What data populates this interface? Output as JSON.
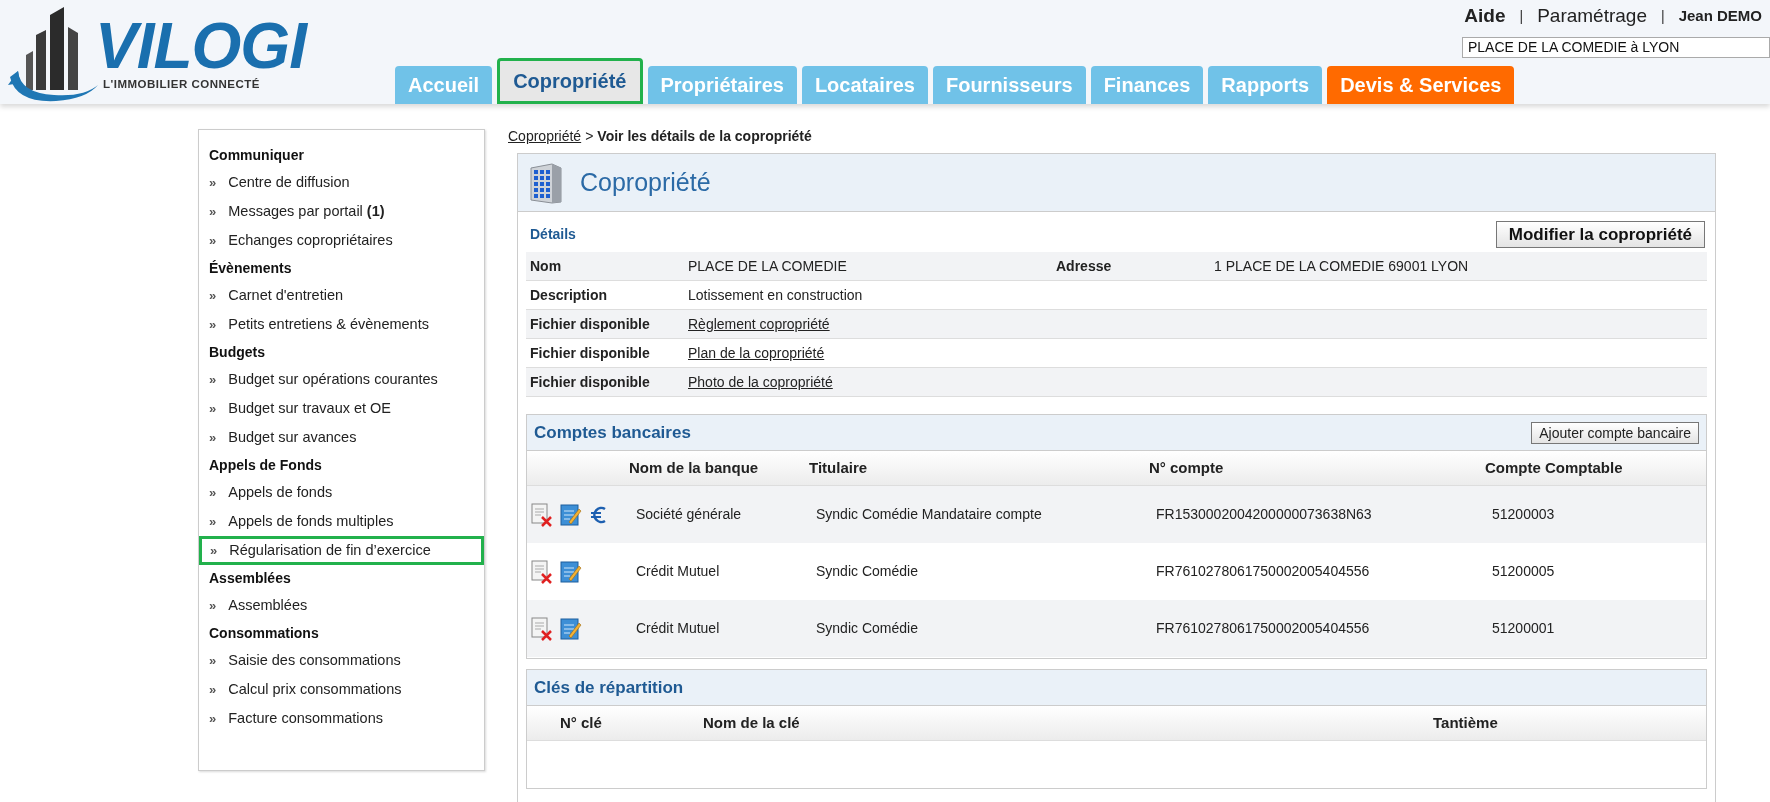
{
  "header": {
    "logo": {
      "name": "VILOGI",
      "tagline": "L'IMMOBILIER CONNECTÉ"
    },
    "top_links": [
      {
        "label": "Aide",
        "kind": "bold"
      },
      {
        "label": "|",
        "kind": "separator"
      },
      {
        "label": "Paramétrage",
        "kind": "plain"
      },
      {
        "label": "|",
        "kind": "separator"
      },
      {
        "label": "Jean DEMO",
        "kind": "user"
      }
    ],
    "search": {
      "value": "PLACE DE LA COMEDIE à LYON"
    },
    "tabs": [
      {
        "label": "Accueil",
        "selected": false,
        "highlighted": false,
        "kind": "normal"
      },
      {
        "label": "Copropriété",
        "selected": true,
        "highlighted": true,
        "kind": "normal"
      },
      {
        "label": "Propriétaires",
        "selected": false,
        "highlighted": false,
        "kind": "normal"
      },
      {
        "label": "Locataires",
        "selected": false,
        "highlighted": false,
        "kind": "normal"
      },
      {
        "label": "Fournisseurs",
        "selected": false,
        "highlighted": false,
        "kind": "normal"
      },
      {
        "label": "Finances",
        "selected": false,
        "highlighted": false,
        "kind": "normal"
      },
      {
        "label": "Rapports",
        "selected": false,
        "highlighted": false,
        "kind": "normal"
      },
      {
        "label": "Devis & Services",
        "selected": false,
        "highlighted": false,
        "kind": "accent"
      }
    ]
  },
  "sidebar": {
    "marker": "»",
    "sections": [
      {
        "title": "Communiquer",
        "items": [
          {
            "label": "Centre de diffusion",
            "highlighted": false
          },
          {
            "label": "Messages par portail **(1)**",
            "highlighted": false
          },
          {
            "label": "Echanges copropriétaires",
            "highlighted": false
          }
        ]
      },
      {
        "title": "Évènements",
        "items": [
          {
            "label": "Carnet d'entretien",
            "highlighted": false
          },
          {
            "label": "Petits entretiens & évènements",
            "highlighted": false
          }
        ]
      },
      {
        "title": "Budgets",
        "items": [
          {
            "label": "Budget sur opérations courantes",
            "highlighted": false
          },
          {
            "label": "Budget sur travaux et OE",
            "highlighted": false
          },
          {
            "label": "Budget sur avances",
            "highlighted": false
          }
        ]
      },
      {
        "title": "Appels de Fonds",
        "items": [
          {
            "label": "Appels de fonds",
            "highlighted": false
          },
          {
            "label": "Appels de fonds multiples",
            "highlighted": false
          },
          {
            "label": "Régularisation de fin d’exercice",
            "highlighted": true
          }
        ]
      },
      {
        "title": "Assemblées",
        "items": [
          {
            "label": "Assemblées",
            "highlighted": false
          }
        ]
      },
      {
        "title": "Consommations",
        "items": [
          {
            "label": "Saisie des consommations",
            "highlighted": false
          },
          {
            "label": "Calcul prix consommations",
            "highlighted": false
          },
          {
            "label": "Facture consommations",
            "highlighted": false
          }
        ]
      }
    ]
  },
  "breadcrumb": {
    "link": "Copropriété",
    "separator": ">",
    "current": "Voir les détails de la copropriété"
  },
  "panel": {
    "title": "Copropriété",
    "details": {
      "title": "Détails",
      "button": "Modifier la copropriété",
      "rows": [
        {
          "label": "Nom",
          "value": "PLACE DE LA COMEDIE",
          "kind": "text",
          "label_2": "Adresse",
          "value_2": "1 PLACE DE LA COMEDIE 69001 LYON"
        },
        {
          "label": "Description",
          "value": "Lotissement en construction",
          "kind": "text"
        },
        {
          "label": "Fichier disponible",
          "value": "Règlement copropriété",
          "kind": "link"
        },
        {
          "label": "Fichier disponible",
          "value": "Plan de la copropriété",
          "kind": "link"
        },
        {
          "label": "Fichier disponible",
          "value": "Photo de la copropriété",
          "kind": "link"
        }
      ]
    },
    "bank_accounts": {
      "title": "Comptes bancaires",
      "button": "Ajouter compte bancaire",
      "columns": [
        "Nom de la banque",
        "Titulaire",
        "N° compte",
        "Compte Comptable"
      ],
      "rows": [
        {
          "actions": [
            {
              "kind": "delete"
            },
            {
              "kind": "edit"
            },
            {
              "kind": "euro"
            }
          ],
          "cells": [
            "Société générale",
            "Syndic Comédie Mandataire compte",
            "FR1530002004200000073638N63",
            "51200003"
          ]
        },
        {
          "actions": [
            {
              "kind": "delete"
            },
            {
              "kind": "edit"
            }
          ],
          "cells": [
            "Crédit Mutuel",
            "Syndic Comédie",
            "FR7610278061750002005404556",
            "51200005"
          ]
        },
        {
          "actions": [
            {
              "kind": "delete"
            },
            {
              "kind": "edit"
            }
          ],
          "cells": [
            "Crédit Mutuel",
            "Syndic Comédie",
            "FR7610278061750002005404556",
            "51200001"
          ]
        }
      ]
    },
    "keys": {
      "title": "Clés de répartition",
      "columns": [
        "N° clé",
        "Nom de la clé",
        "Tantième"
      ]
    }
  }
}
